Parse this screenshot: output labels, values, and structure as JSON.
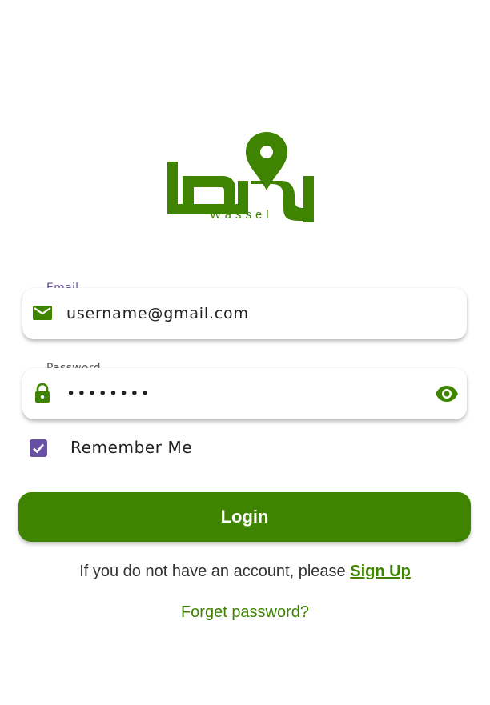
{
  "colors": {
    "brand_green": "#3f8400",
    "accent_purple": "#6750a4",
    "label_gray": "#555555"
  },
  "logo": {
    "latin_text": "Wassel",
    "arabic_text": "وصل",
    "icon": "map-pin-icon"
  },
  "email_field": {
    "label": "Email",
    "value": "username@gmail.com",
    "icon": "mail-icon"
  },
  "password_field": {
    "label": "Password",
    "value": "••••••••",
    "icon": "lock-icon",
    "toggle_icon": "eye-icon"
  },
  "remember_me": {
    "label": "Remember Me",
    "checked": true
  },
  "login_button": {
    "label": "Login"
  },
  "signup": {
    "prompt": "If you do not have an account, please ",
    "link_label": "Sign Up"
  },
  "forget_password": {
    "label": "Forget password?"
  }
}
